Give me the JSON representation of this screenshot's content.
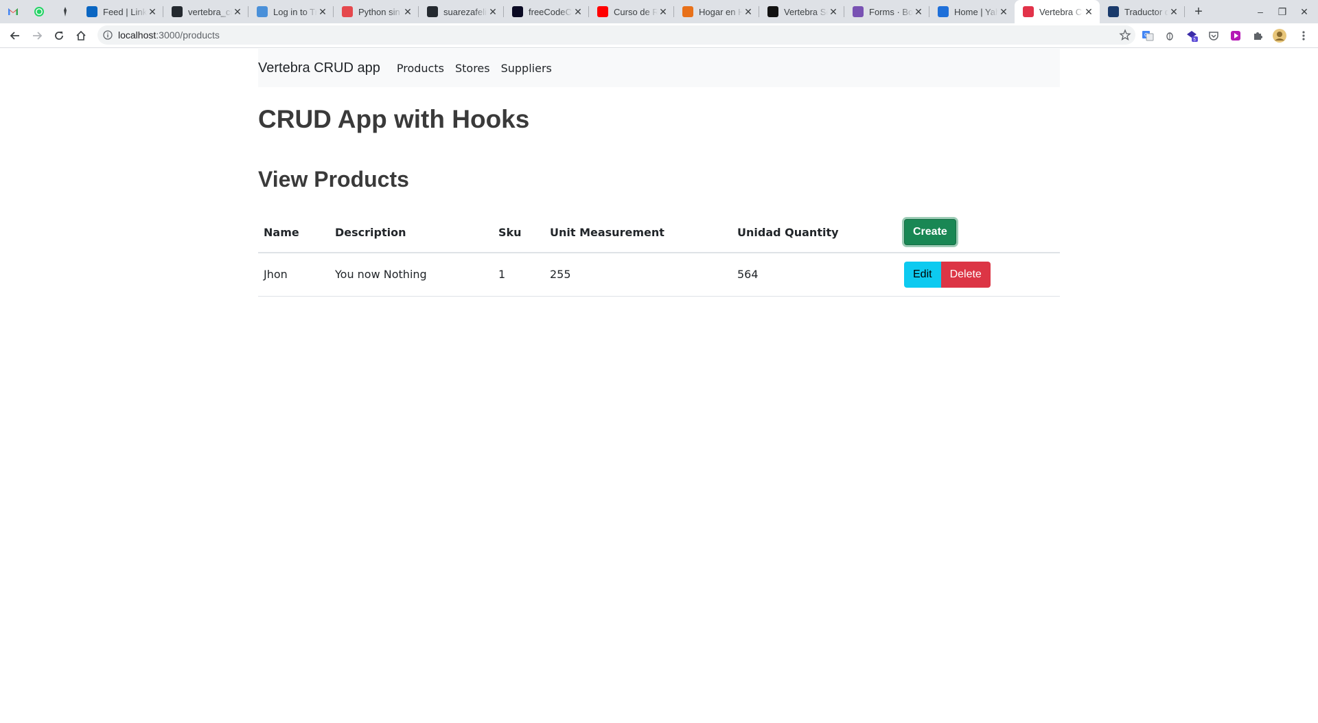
{
  "browser": {
    "tabs": [
      {
        "title": "",
        "favicon": "gmail-icon",
        "color": "#ea4335",
        "pinned": true
      },
      {
        "title": "",
        "favicon": "whatsapp-icon",
        "color": "#25d366",
        "pinned": true
      },
      {
        "title": "",
        "favicon": "bookmark-icon",
        "color": "#3c4043",
        "pinned": true
      },
      {
        "title": "Feed | LinkedIn",
        "favicon": "linkedin-icon",
        "color": "#0a66c2"
      },
      {
        "title": "vertebra_crud",
        "favicon": "github-icon",
        "color": "#24292f"
      },
      {
        "title": "Log in to Trello",
        "favicon": "trello-icon",
        "color": "#4a90d9"
      },
      {
        "title": "Python sin fronteras",
        "favicon": "python-icon",
        "color": "#e5484d"
      },
      {
        "title": "suarezafelipe",
        "favicon": "github-icon",
        "color": "#24292f"
      },
      {
        "title": "freeCodeCamp",
        "favicon": "freecodecamp-icon",
        "color": "#0a0a23"
      },
      {
        "title": "Curso de React",
        "favicon": "youtube-icon",
        "color": "#ff0000"
      },
      {
        "title": "Hogar en Holanda",
        "favicon": "hogar-icon",
        "color": "#e8711a"
      },
      {
        "title": "Vertebra Software",
        "favicon": "vertebra-icon",
        "color": "#111111"
      },
      {
        "title": "Forms · Bootstrap",
        "favicon": "bootstrap-icon",
        "color": "#7952b3"
      },
      {
        "title": "Home | Yahoo",
        "favicon": "home-icon",
        "color": "#1e6fd9"
      },
      {
        "title": "Vertebra CRUD",
        "favicon": "vertebra-t-icon",
        "color": "#e2334a",
        "active": true
      },
      {
        "title": "Traductor de Google",
        "favicon": "translate-icon",
        "color": "#1a3a6b"
      }
    ],
    "new_tab": "+",
    "window": {
      "minimize": "–",
      "restore": "❐",
      "close": "✕"
    },
    "url_host": "localhost",
    "url_rest": ":3000/products",
    "extensions": [
      "google-translate-icon",
      "bug-icon",
      "extension-badge-icon",
      "pocket-icon",
      "media-icon",
      "puzzle-icon",
      "profile-avatar-icon",
      "menu-dots-icon"
    ]
  },
  "navbar": {
    "brand": "Vertebra CRUD app",
    "links": [
      "Products",
      "Stores",
      "Suppliers"
    ]
  },
  "page": {
    "title": "CRUD App with Hooks",
    "subtitle": "View Products"
  },
  "table": {
    "headers": [
      "Name",
      "Description",
      "Sku",
      "Unit Measurement",
      "Unidad Quantity"
    ],
    "create_label": "Create",
    "rows": [
      {
        "name": "Jhon",
        "description": "You now Nothing",
        "sku": "1",
        "unit_measurement": "255",
        "unidad_quantity": "564"
      }
    ],
    "edit_label": "Edit",
    "delete_label": "Delete"
  },
  "colors": {
    "create": "#198754",
    "edit": "#0dcaf0",
    "delete": "#dc3545",
    "navbar_bg": "#f8f9fa"
  }
}
